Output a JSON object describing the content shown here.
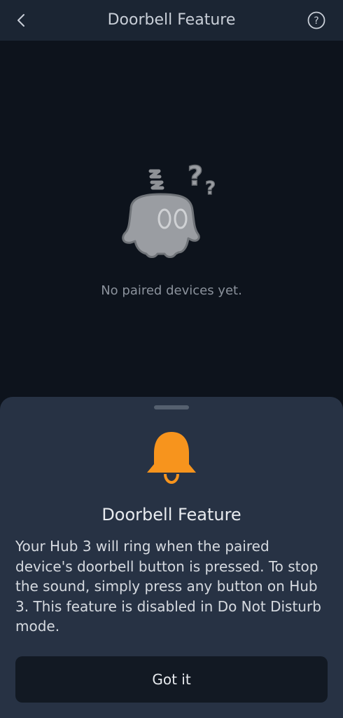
{
  "header": {
    "title": "Doorbell Feature",
    "back_icon": "chevron-left-icon",
    "help_icon": "help-circle-icon"
  },
  "empty_state": {
    "illustration": "confused-ghost-illustration",
    "message": "No paired devices yet."
  },
  "sheet": {
    "icon": "bell-icon",
    "title": "Doorbell Feature",
    "body": "Your Hub 3 will ring when the paired device's doorbell button is pressed. To stop the sound, simply press any button on Hub 3. This feature is disabled in Do Not Disturb mode.",
    "button_label": "Got it"
  },
  "colors": {
    "background": "#0d131c",
    "header": "#1b2533",
    "sheet": "#273244",
    "button": "#121923",
    "accent_bell": "#f7941d"
  }
}
